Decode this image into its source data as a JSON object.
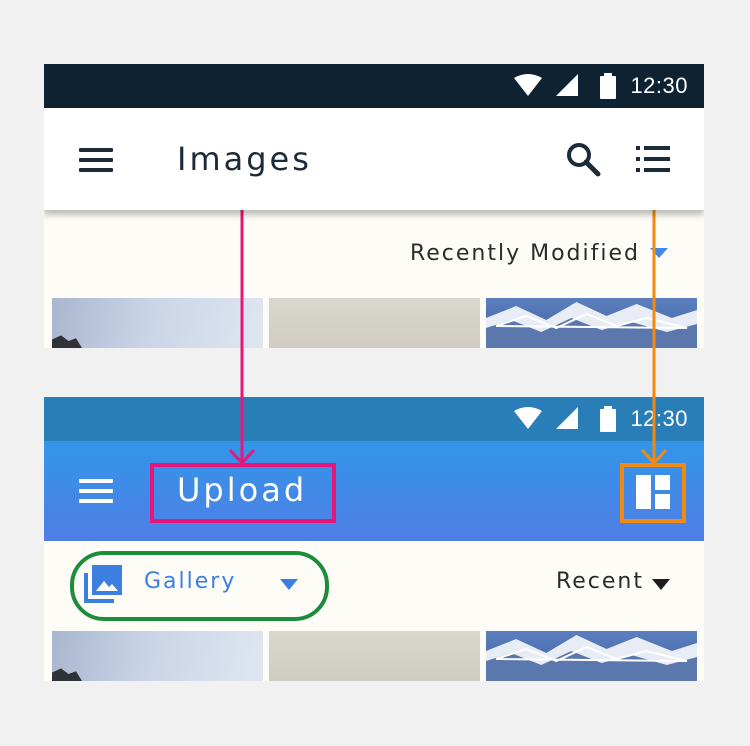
{
  "status_bar": {
    "time": "12:30"
  },
  "top_screen": {
    "title": "Images",
    "sort_label": "Recently Modified",
    "icons": [
      "menu-icon",
      "search-icon",
      "list-view-icon",
      "dropdown-arrow-icon"
    ]
  },
  "bottom_screen": {
    "title": "Upload",
    "source_label": "Gallery",
    "sort_label": "Recent",
    "icons": [
      "menu-icon",
      "grid-view-icon",
      "gallery-icon",
      "dropdown-arrow-icon"
    ]
  },
  "colors": {
    "pink_annotation": "#e8167a",
    "orange_annotation": "#f28a12",
    "green_annotation": "#1d8c3d",
    "top_status_bar": "#0f2231",
    "bottom_status_bar": "#2a7eb8",
    "bottom_app_bar": "#3f8ae6",
    "accent_blue": "#3c7fe0"
  }
}
